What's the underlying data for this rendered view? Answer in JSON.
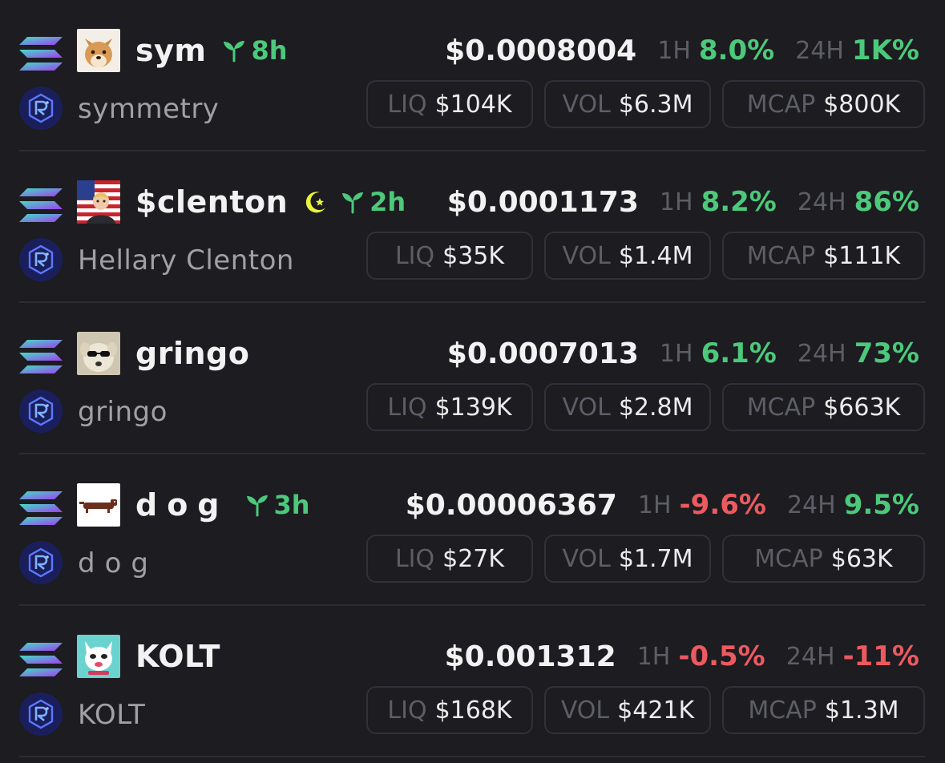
{
  "colors": {
    "background": "#1c1c21",
    "positive": "#4cc97a",
    "negative": "#ec5a5f",
    "muted": "#5d5e66",
    "subtext": "#a0a0a7"
  },
  "labels": {
    "h1": "1H",
    "h24": "24H",
    "liq": "LIQ",
    "vol": "VOL",
    "mcap": "MCAP"
  },
  "tokens": [
    {
      "ticker": "sym",
      "name": "symmetry",
      "age": "8h",
      "moon": false,
      "avatar": "shiba-dog-avatar",
      "price": "$0.0008004",
      "change_1h": "8.0%",
      "change_1h_dir": "up",
      "change_24h": "1K%",
      "change_24h_dir": "up",
      "liq": "$104K",
      "vol": "$6.3M",
      "mcap": "$800K"
    },
    {
      "ticker": "$clenton",
      "name": "Hellary Clenton",
      "age": "2h",
      "moon": true,
      "avatar": "us-flag-character-avatar",
      "price": "$0.0001173",
      "change_1h": "8.2%",
      "change_1h_dir": "up",
      "change_24h": "86%",
      "change_24h_dir": "up",
      "liq": "$35K",
      "vol": "$1.4M",
      "mcap": "$111K"
    },
    {
      "ticker": "gringo",
      "name": "gringo",
      "age": "",
      "moon": false,
      "avatar": "sunglasses-dog-avatar",
      "price": "$0.0007013",
      "change_1h": "6.1%",
      "change_1h_dir": "up",
      "change_24h": "73%",
      "change_24h_dir": "up",
      "liq": "$139K",
      "vol": "$2.8M",
      "mcap": "$663K"
    },
    {
      "ticker": "dog",
      "name": "dog",
      "age": "3h",
      "moon": false,
      "avatar": "dachshund-avatar",
      "price": "$0.00006367",
      "change_1h": "-9.6%",
      "change_1h_dir": "down",
      "change_24h": "9.5%",
      "change_24h_dir": "up",
      "liq": "$27K",
      "vol": "$1.7M",
      "mcap": "$63K"
    },
    {
      "ticker": "KOLT",
      "name": "KOLT",
      "age": "",
      "moon": false,
      "avatar": "cartoon-cat-avatar",
      "price": "$0.001312",
      "change_1h": "-0.5%",
      "change_1h_dir": "down",
      "change_24h": "-11%",
      "change_24h_dir": "down",
      "liq": "$168K",
      "vol": "$421K",
      "mcap": "$1.3M"
    }
  ]
}
